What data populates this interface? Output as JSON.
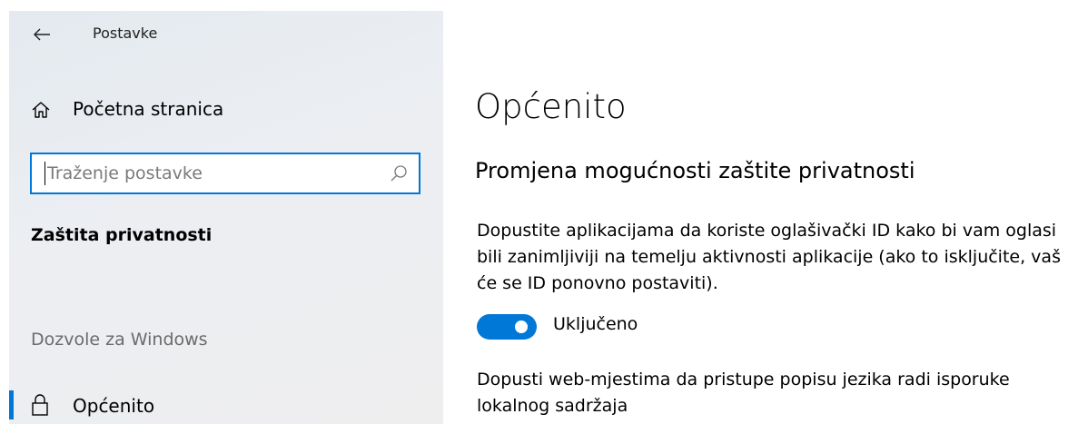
{
  "window": {
    "title": "Postavke"
  },
  "sidebar": {
    "home_label": "Početna stranica",
    "search": {
      "value": "",
      "placeholder": "Traženje postavke"
    },
    "section_title": "Zaštita privatnosti",
    "group_title": "Dozvole za Windows",
    "items": [
      {
        "label": "Općenito",
        "icon": "lock-icon",
        "selected": true
      }
    ]
  },
  "main": {
    "title": "Općenito",
    "subheading": "Promjena mogućnosti zaštite privatnosti",
    "settings": [
      {
        "description_lines": [
          "Dopustite aplikacijama da koriste oglašivački ID kako bi vam oglasi",
          "bili zanimljiviji na temelju aktivnosti aplikacije (ako to isključite, vaš",
          "će se ID ponovno postaviti)."
        ],
        "toggle_state": "Uključeno",
        "toggle_on": true
      },
      {
        "description_lines": [
          "Dopusti web-mjestima da pristupe popisu jezika radi isporuke",
          "lokalnog sadržaja"
        ]
      }
    ]
  },
  "colors": {
    "accent": "#0078d7",
    "sidebar_bg": "#eceef2",
    "muted_text": "#6b6b6b"
  },
  "icons": [
    "back-arrow-icon",
    "home-icon",
    "search-icon",
    "lock-icon"
  ]
}
